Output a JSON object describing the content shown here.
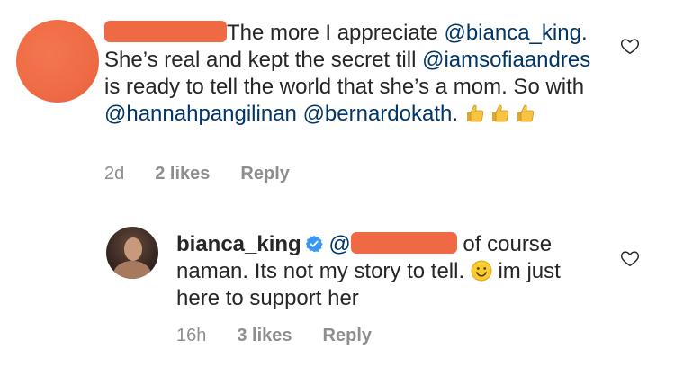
{
  "comment_1": {
    "text_intro": "The more I appreciate",
    "mention_1": "@bianca_king",
    "text_1": ". She’s real and kept the secret till ",
    "mention_2": "@iamsofiaandres",
    "text_2": " is ready to tell the world that she’s a mom. So with ",
    "mention_3": "@hannahpangilinan",
    "text_3": " ",
    "mention_4": "@bernardokath",
    "text_4": ". ",
    "emoji_name": "thumbs-up-icon",
    "time": "2d",
    "likes": "2 likes",
    "reply_label": "Reply"
  },
  "comment_2": {
    "username": "bianca_king",
    "mention": "@",
    "text_1": " of course naman.  Its not my story to tell. ",
    "emoji_name": "smile-icon",
    "text_2": " im just here to support her",
    "time": "16h",
    "likes": "3 likes",
    "reply_label": "Reply"
  },
  "colors": {
    "text": "#262626",
    "mention": "#003569",
    "meta": "#8e8e8e",
    "redaction": "#ef6a44",
    "verified": "#3897f0"
  }
}
